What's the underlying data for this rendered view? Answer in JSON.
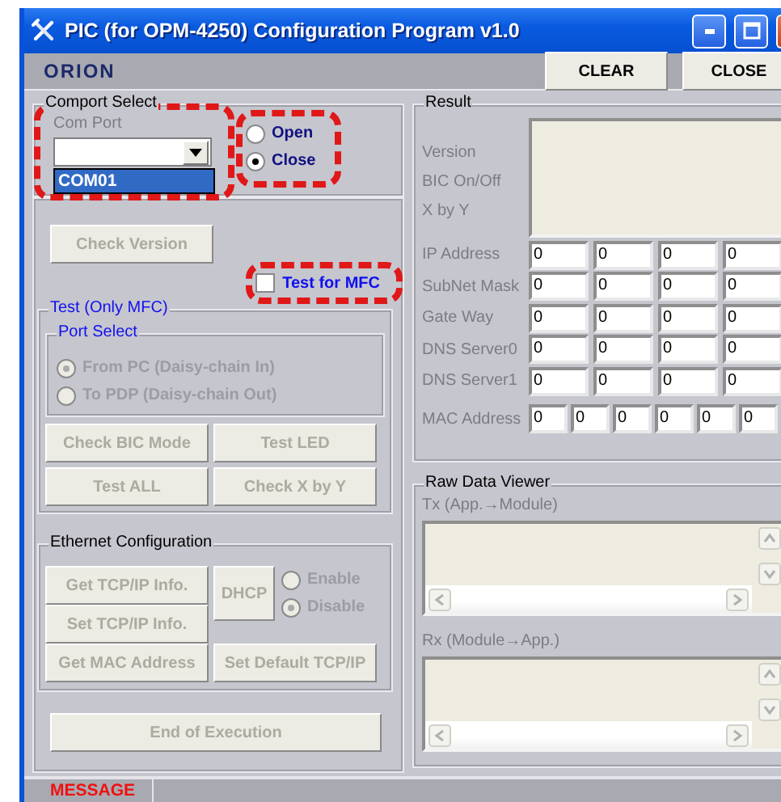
{
  "window": {
    "title": "PIC (for OPM-4250) Configuration Program v1.0"
  },
  "toolbar": {
    "logo": "ORION",
    "buttons": [
      {
        "label": "CLEAR",
        "disabled": false
      },
      {
        "label": "CLOSE",
        "disabled": false
      }
    ]
  },
  "comport_select": {
    "title": "Comport Select",
    "combo": {
      "label": "Com Port",
      "highlighted": true,
      "dropdown_items": [
        {
          "label": "COM01",
          "selected": true
        }
      ]
    },
    "radio_group": {
      "highlighted": true,
      "radios": [
        {
          "label": "Open",
          "selected": false
        },
        {
          "label": "Close",
          "selected": true
        }
      ]
    }
  },
  "check_version": {
    "label": "Check Version",
    "disabled": true
  },
  "test_for_mfc": {
    "label": "Test for MFC",
    "checked": false,
    "highlighted": true
  },
  "test_group": {
    "title": "Test (Only MFC)",
    "port_select": {
      "title": "Port Select",
      "radios": [
        {
          "label": "From PC (Daisy-chain In)",
          "selected": true,
          "disabled": true
        },
        {
          "label": "To PDP (Daisy-chain Out)",
          "selected": false,
          "disabled": true
        }
      ]
    },
    "buttons": [
      {
        "label": "Check BIC Mode",
        "disabled": true
      },
      {
        "label": "Test LED",
        "disabled": true
      },
      {
        "label": "Test ALL",
        "disabled": true
      },
      {
        "label": "Check X by Y",
        "disabled": true
      }
    ]
  },
  "ethernet": {
    "title": "Ethernet Configuration",
    "get_tcp": {
      "label": "Get TCP/IP Info.",
      "disabled": true
    },
    "set_tcp": {
      "label": "Set TCP/IP Info.",
      "disabled": true
    },
    "dhcp": {
      "label": "DHCP",
      "disabled": true
    },
    "dhcp_radios": [
      {
        "label": "Enable",
        "selected": false,
        "disabled": true
      },
      {
        "label": "Disable",
        "selected": true,
        "disabled": true
      }
    ],
    "get_mac": {
      "label": "Get MAC Address",
      "disabled": true
    },
    "set_default": {
      "label": "Set Default TCP/IP",
      "disabled": true
    }
  },
  "end_button": {
    "label": "End of Execution",
    "disabled": true
  },
  "result": {
    "title": "Result",
    "labels": [
      "Version",
      "BIC On/Off",
      "X by Y"
    ],
    "rows": [
      {
        "label": "IP Address",
        "values": [
          "0",
          "0",
          "0",
          "0"
        ]
      },
      {
        "label": "SubNet Mask",
        "values": [
          "0",
          "0",
          "0",
          "0"
        ]
      },
      {
        "label": "Gate Way",
        "values": [
          "0",
          "0",
          "0",
          "0"
        ]
      },
      {
        "label": "DNS Server0",
        "values": [
          "0",
          "0",
          "0",
          "0"
        ]
      },
      {
        "label": "DNS Server1",
        "values": [
          "0",
          "0",
          "0",
          "0"
        ]
      }
    ],
    "mac": {
      "label": "MAC Address",
      "values": [
        "0",
        "0",
        "0",
        "0",
        "0",
        "0"
      ]
    }
  },
  "raw_data_viewer": {
    "title": "Raw Data Viewer",
    "panes": [
      {
        "label": "Tx (App.→Module)"
      },
      {
        "label": "Rx (Module→App.)"
      }
    ]
  },
  "status_bar": {
    "message": "MESSAGE"
  }
}
